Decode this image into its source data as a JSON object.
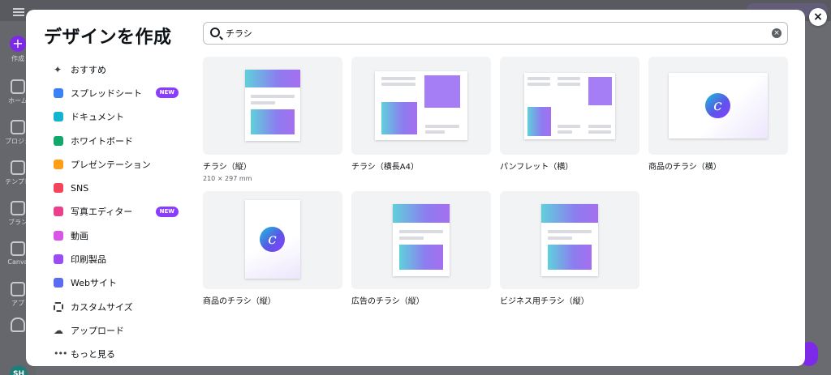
{
  "background": {
    "rail": [
      {
        "label": "作成"
      },
      {
        "label": "ホーム"
      },
      {
        "label": "プロジェ"
      },
      {
        "label": "テンプレ"
      },
      {
        "label": "ブラン"
      },
      {
        "label": "Canva"
      },
      {
        "label": "アプ"
      }
    ],
    "avatar": "SH"
  },
  "modal": {
    "title": "デザインを作成",
    "close_label": "×",
    "search": {
      "value": "チラシ",
      "clear_label": "×"
    },
    "menu": [
      {
        "label": "おすすめ",
        "icon": "sparkle-icon",
        "color": "#3d3f43"
      },
      {
        "label": "スプレッドシート",
        "icon": "spreadsheet-icon",
        "color": "#3b82f6",
        "badge": "NEW"
      },
      {
        "label": "ドキュメント",
        "icon": "document-icon",
        "color": "#12b5cb"
      },
      {
        "label": "ホワイトボード",
        "icon": "whiteboard-icon",
        "color": "#13a86b"
      },
      {
        "label": "プレゼンテーション",
        "icon": "presentation-icon",
        "color": "#ff9d14"
      },
      {
        "label": "SNS",
        "icon": "heart-icon",
        "color": "#f2455d"
      },
      {
        "label": "写真エディター",
        "icon": "camera-icon",
        "color": "#ec3f8c",
        "badge": "NEW"
      },
      {
        "label": "動画",
        "icon": "video-icon",
        "color": "#d855e8"
      },
      {
        "label": "印刷製品",
        "icon": "printer-icon",
        "color": "#9a4df0"
      },
      {
        "label": "Webサイト",
        "icon": "website-icon",
        "color": "#5a6cf2"
      },
      {
        "label": "カスタムサイズ",
        "icon": "crop-icon",
        "color": "#3d3f43"
      },
      {
        "label": "アップロード",
        "icon": "upload-cloud-icon",
        "color": "#3d3f43"
      },
      {
        "label": "もっと見る",
        "icon": "more-icon",
        "color": "#3d3f43"
      }
    ],
    "results": [
      {
        "title": "チラシ（縦）",
        "subtitle": "210 × 297 mm",
        "thumb": "flyer-portrait"
      },
      {
        "title": "チラシ（横長A4）",
        "thumb": "flyer-landscape"
      },
      {
        "title": "パンフレット（横）",
        "thumb": "brochure-landscape"
      },
      {
        "title": "商品のチラシ（横）",
        "thumb": "product-landscape"
      },
      {
        "title": "商品のチラシ（縦）",
        "thumb": "product-portrait"
      },
      {
        "title": "広告のチラシ（縦）",
        "thumb": "ad-portrait"
      },
      {
        "title": "ビジネス用チラシ（縦）",
        "thumb": "business-portrait"
      }
    ]
  },
  "colors": {
    "accent": "#8b3dff",
    "overlay": "#5e5e63"
  }
}
